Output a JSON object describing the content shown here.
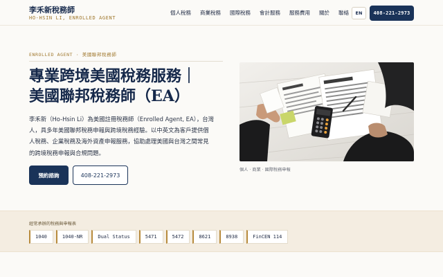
{
  "header": {
    "brand_name": "李禾新稅務師",
    "brand_sub": "HO-HSIN LI, ENROLLED AGENT",
    "nav": [
      "個人稅務",
      "商業稅務",
      "國際稅務",
      "會計服務",
      "服務費用",
      "關於",
      "聯絡"
    ],
    "lang": "EN",
    "phone": "408-221-2973"
  },
  "hero": {
    "eyebrow": "ENROLLED AGENT · 美國聯邦稅務師",
    "title_lines": [
      "專業跨境美國稅務服務｜",
      "美國聯邦稅務師（EA）"
    ],
    "desc_lines": [
      "李禾新（Ho-Hsin Li）為美國註冊稅務師（Enrolled Agent, EA），台灣",
      "人，具多年美國聯邦稅務申報與跨境稅務經驗。以中英文為客戶提供個",
      "人稅務、企業稅務及海外資產申報服務，協助處理美國與台灣之間常見",
      "的跨境稅務申報與合規問題。"
    ],
    "cta_primary": "預約諮詢",
    "cta_secondary": "408-221-2973",
    "photo_caption": "個人 · 商業 · 國際稅務申報"
  },
  "forms": {
    "label": "經常承辦的稅務與申報表",
    "items": [
      "1040",
      "1040-NR",
      "Dual Status",
      "5471",
      "5472",
      "8621",
      "8938",
      "FinCEN 114"
    ]
  },
  "colors": {
    "navy": "#1a3359",
    "gold": "#a0782e",
    "background": "#fbfaf7",
    "band": "#f4ede1"
  }
}
